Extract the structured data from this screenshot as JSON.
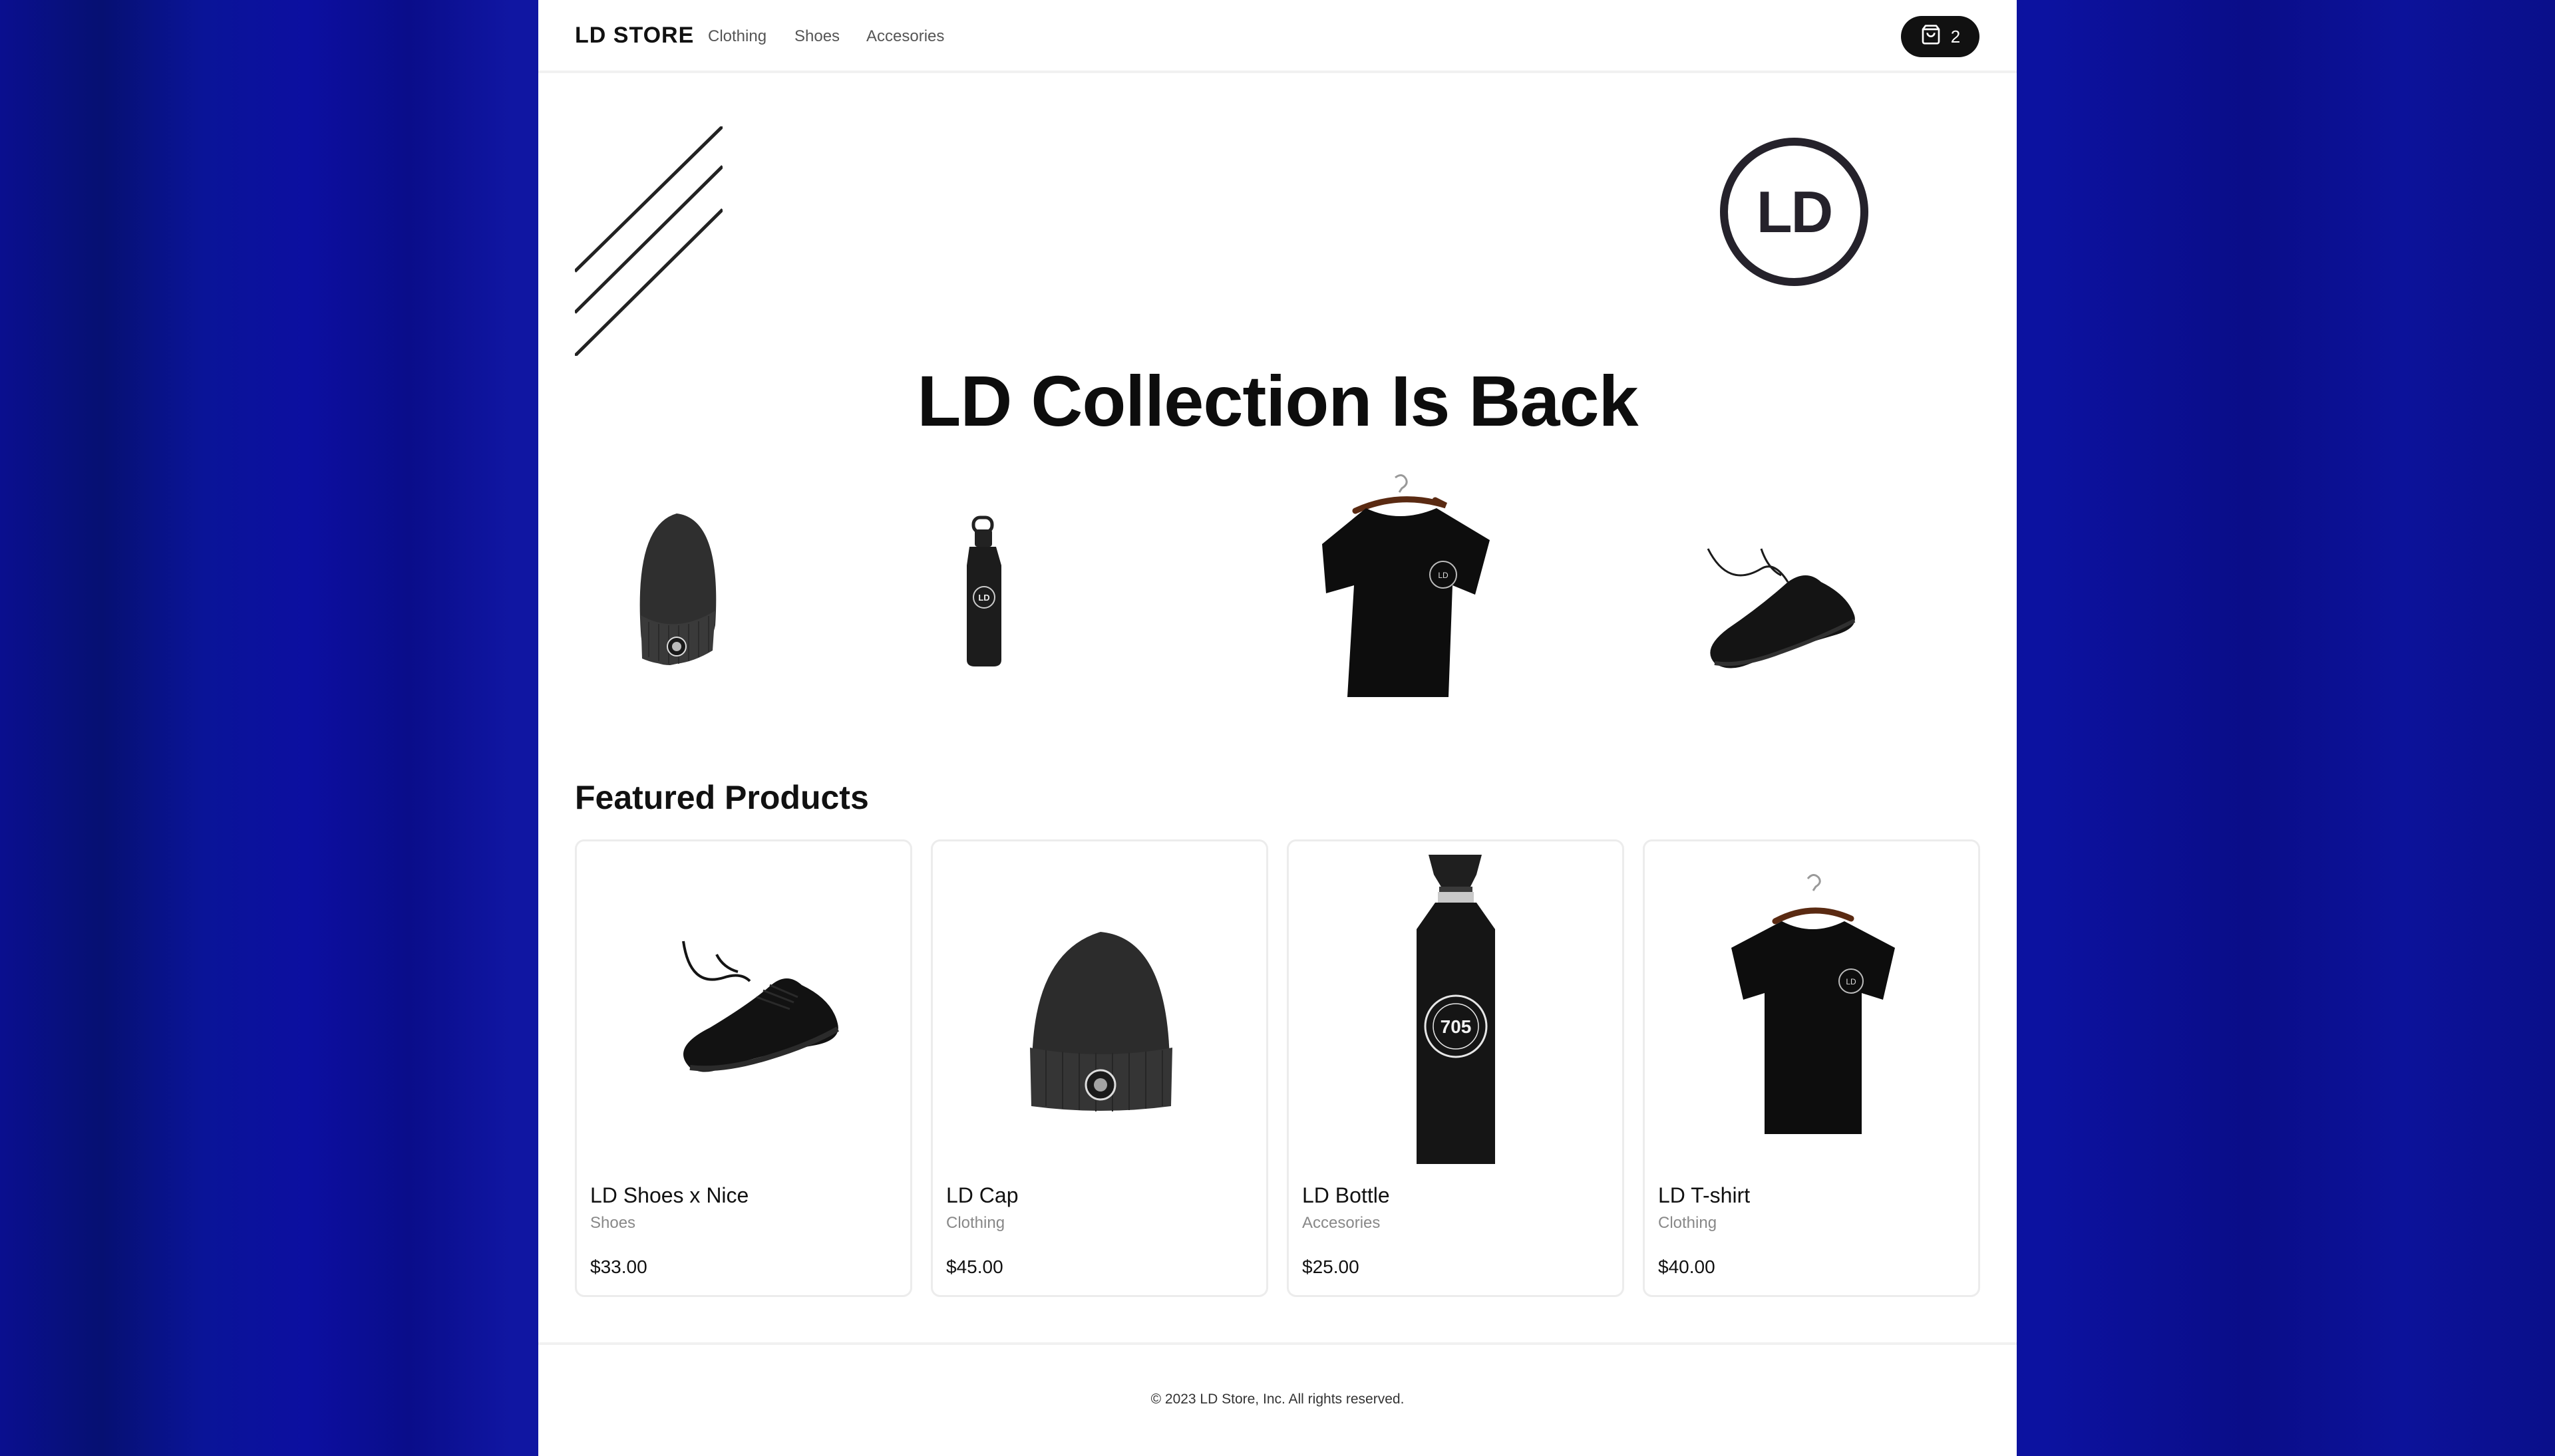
{
  "header": {
    "brand": "LD STORE",
    "nav": [
      "Clothing",
      "Shoes",
      "Accesories"
    ],
    "cart_count": "2"
  },
  "hero": {
    "logo_text": "LD",
    "title": "LD Collection Is Back",
    "items": [
      "beanie",
      "bottle",
      "t-shirt",
      "sneaker"
    ]
  },
  "featured": {
    "title": "Featured Products",
    "products": [
      {
        "name": "LD Shoes x Nice",
        "category": "Shoes",
        "price": "$33.00",
        "image": "sneaker"
      },
      {
        "name": "LD Cap",
        "category": "Clothing",
        "price": "$45.00",
        "image": "beanie"
      },
      {
        "name": "LD Bottle",
        "category": "Accesories",
        "price": "$25.00",
        "image": "bottle",
        "badge": "705"
      },
      {
        "name": "LD T-shirt",
        "category": "Clothing",
        "price": "$40.00",
        "image": "t-shirt"
      }
    ]
  },
  "footer": {
    "copyright": "© 2023 LD Store, Inc. All rights reserved."
  },
  "colors": {
    "background": "#0a0f8f",
    "page": "#ffffff",
    "primary": "#111111",
    "muted": "#888888"
  }
}
